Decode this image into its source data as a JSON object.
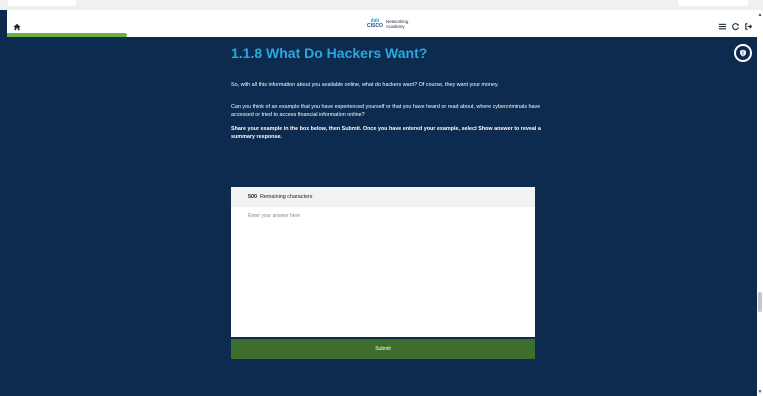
{
  "header": {
    "logo": {
      "brand": "CISCO",
      "product": "Networking",
      "sub": "Academy"
    },
    "icons": [
      "home-icon",
      "menu-icon",
      "refresh-icon",
      "exit-icon"
    ],
    "progress": 0.16,
    "progress_color": "#6cb043"
  },
  "page": {
    "title": "1.1.8 What Do Hackers Want?",
    "paragraphs": [
      "So, with all this information about you available online, what do hackers want? Of course, they want your money.",
      "Can you think of an example that you have experienced yourself or that you have heard or read about, where cybercriminals have accessed or tried to access financial information online?",
      "Share your example in the box below, then Submit. Once you have entered your example, select Show answer to reveal a summary response."
    ]
  },
  "answer_box": {
    "remaining_count": "500",
    "remaining_label": "Remaining characters",
    "placeholder": "Enter your answer here",
    "value": ""
  },
  "submit_label": "Submit",
  "colors": {
    "background": "#0d2b4e",
    "title": "#29a8e0",
    "submit": "#3e6e2c",
    "header": "#ffffff"
  }
}
